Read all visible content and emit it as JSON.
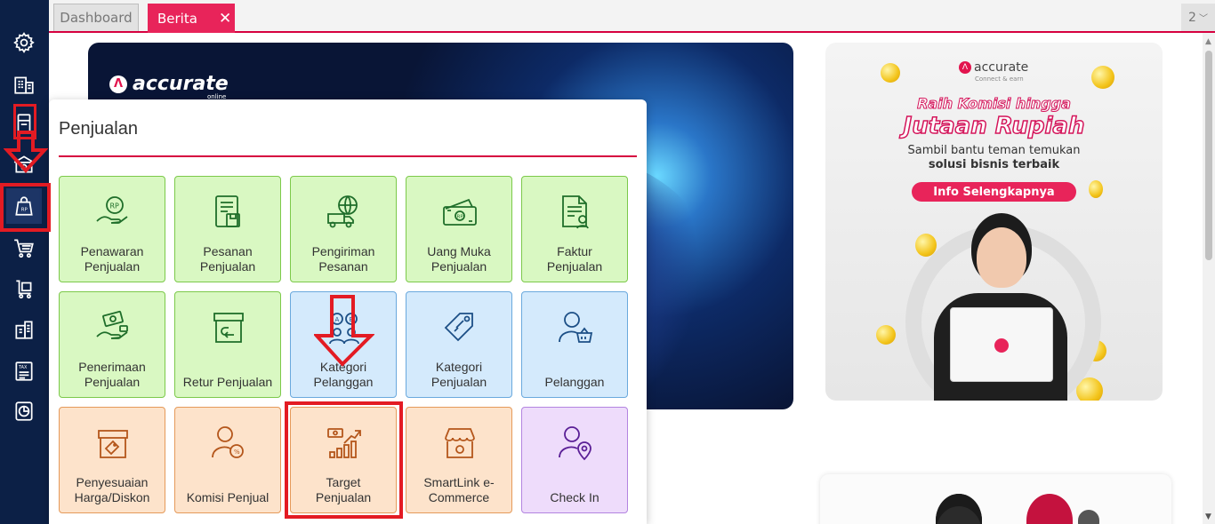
{
  "tabs": {
    "dashboard": "Dashboard",
    "berita": "Berita",
    "berita_close": "✕",
    "count": "2",
    "count_caret": "﹀"
  },
  "sidebar": {
    "icons": [
      "settings-icon",
      "company-icon",
      "inventory-icon",
      "cash-bank-icon",
      "sales-icon",
      "purchase-icon",
      "purchase-order-icon",
      "asset-icon",
      "tax-icon",
      "report-icon"
    ],
    "active": "sales-icon"
  },
  "banner_left": {
    "logo": "accurate",
    "logo_sub": "online"
  },
  "banner_right": {
    "logo": "accurate",
    "logo_sub": "Connect & earn",
    "headline_1": "Raih Komisi hingga",
    "headline_2": "Jutaan Rupiah",
    "text_1": "Sambil bantu teman temukan",
    "text_2": "solusi bisnis terbaik",
    "button": "Info Selengkapnya"
  },
  "menu": {
    "title": "Penjualan",
    "tiles": [
      {
        "label": "Penawaran\nPenjualan",
        "color": "green",
        "icon": "quotation-icon"
      },
      {
        "label": "Pesanan\nPenjualan",
        "color": "green",
        "icon": "sales-order-icon"
      },
      {
        "label": "Pengiriman\nPesanan",
        "color": "green",
        "icon": "delivery-icon"
      },
      {
        "label": "Uang Muka\nPenjualan",
        "color": "green",
        "icon": "down-payment-icon"
      },
      {
        "label": "Faktur\nPenjualan",
        "color": "green",
        "icon": "invoice-icon"
      },
      {
        "label": "Penerimaan\nPenjualan",
        "color": "green",
        "icon": "receipt-icon"
      },
      {
        "label": "Retur Penjualan",
        "color": "green",
        "icon": "return-icon"
      },
      {
        "label": "Kategori\nPelanggan",
        "color": "blue",
        "icon": "customer-category-icon"
      },
      {
        "label": "Kategori\nPenjualan",
        "color": "blue",
        "icon": "sales-category-icon"
      },
      {
        "label": "Pelanggan",
        "color": "blue",
        "icon": "customer-icon"
      },
      {
        "label": "Penyesuaian\nHarga/Diskon",
        "color": "orange",
        "icon": "price-adjustment-icon"
      },
      {
        "label": "Komisi Penjual",
        "color": "orange",
        "icon": "commission-icon"
      },
      {
        "label": "Target\nPenjualan",
        "color": "orange",
        "icon": "sales-target-icon"
      },
      {
        "label": "SmartLink e-\nCommerce",
        "color": "orange",
        "icon": "ecommerce-icon"
      },
      {
        "label": "Check In",
        "color": "purple",
        "icon": "check-in-icon"
      }
    ]
  }
}
